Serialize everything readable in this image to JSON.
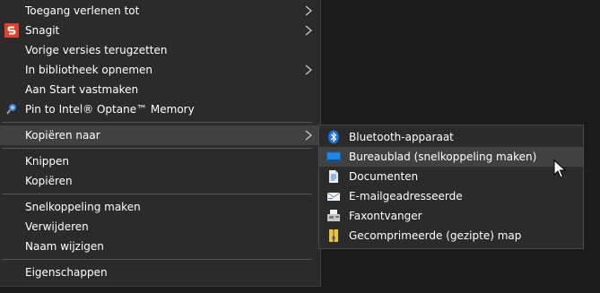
{
  "menu": {
    "items": [
      {
        "label": "Toegang verlenen tot",
        "submenu": true,
        "icon": null
      },
      {
        "label": "Snagit",
        "submenu": true,
        "icon": "snagit-icon"
      },
      {
        "label": "Vorige versies terugzetten",
        "submenu": false,
        "icon": null
      },
      {
        "label": "In bibliotheek opnemen",
        "submenu": true,
        "icon": null
      },
      {
        "label": "Aan Start vastmaken",
        "submenu": false,
        "icon": null
      },
      {
        "label": "Pin to Intel® Optane™ Memory",
        "submenu": false,
        "icon": "optane-icon"
      },
      {
        "label": "Kopiëren naar",
        "submenu": true,
        "icon": null,
        "highlighted": true
      },
      {
        "label": "Knippen",
        "submenu": false,
        "icon": null
      },
      {
        "label": "Kopiëren",
        "submenu": false,
        "icon": null
      },
      {
        "label": "Snelkoppeling maken",
        "submenu": false,
        "icon": null
      },
      {
        "label": "Verwijderen",
        "submenu": false,
        "icon": null
      },
      {
        "label": "Naam wijzigen",
        "submenu": false,
        "icon": null
      },
      {
        "label": "Eigenschappen",
        "submenu": false,
        "icon": null
      }
    ]
  },
  "submenu": {
    "items": [
      {
        "label": "Bluetooth-apparaat",
        "icon": "bluetooth-icon"
      },
      {
        "label": "Bureaublad (snelkoppeling maken)",
        "icon": "desktop-icon",
        "highlighted": true
      },
      {
        "label": "Documenten",
        "icon": "documents-icon"
      },
      {
        "label": "E-mailgeadresseerde",
        "icon": "mail-icon"
      },
      {
        "label": "Faxontvanger",
        "icon": "fax-icon"
      },
      {
        "label": "Gecomprimeerde (gezipte) map",
        "icon": "zip-folder-icon"
      }
    ]
  },
  "colors": {
    "menu_bg": "#2b2b2b",
    "highlight_bg": "#414141",
    "separator": "#555555",
    "snagit_red": "#e0402c",
    "bluetooth_blue": "#1e6fd6",
    "text": "#ffffff"
  }
}
